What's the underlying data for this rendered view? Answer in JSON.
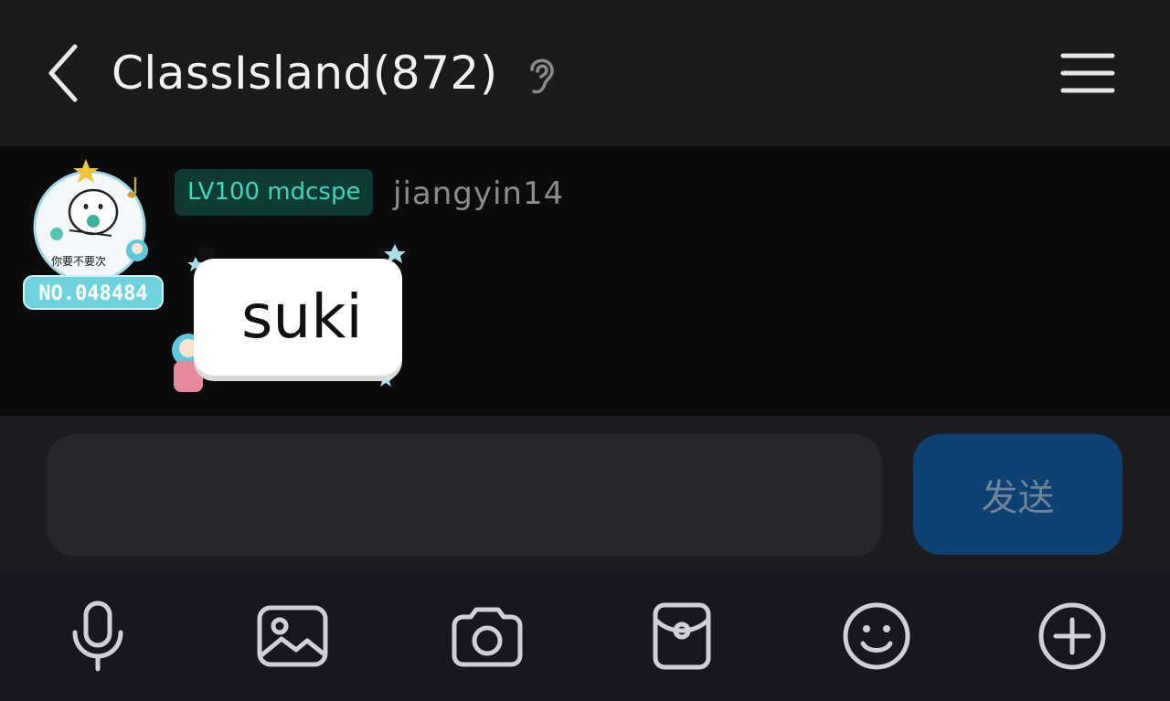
{
  "header": {
    "back_icon": "chevron-left-icon",
    "title": "ClassIsland(872)",
    "ear_icon": "ear-icon",
    "menu_icon": "hamburger-menu-icon"
  },
  "message": {
    "level_badge": "LV100 mdcspe",
    "sender": "jiangyin14",
    "avatar_caption": "你要不要次",
    "avatar_number": "NO.048484",
    "text": "suki"
  },
  "composer": {
    "input_value": "",
    "send_label": "发送"
  },
  "toolbar": {
    "items": [
      {
        "icon": "microphone-icon"
      },
      {
        "icon": "image-icon"
      },
      {
        "icon": "camera-icon"
      },
      {
        "icon": "red-packet-icon"
      },
      {
        "icon": "emoji-icon"
      },
      {
        "icon": "plus-circle-icon"
      }
    ]
  },
  "colors": {
    "header_bg": "#1b1b1b",
    "badge_bg": "#0f3b35",
    "badge_text": "#3fd6bd",
    "send_bg": "#0e4172",
    "toolbar_bg": "#17171f"
  }
}
